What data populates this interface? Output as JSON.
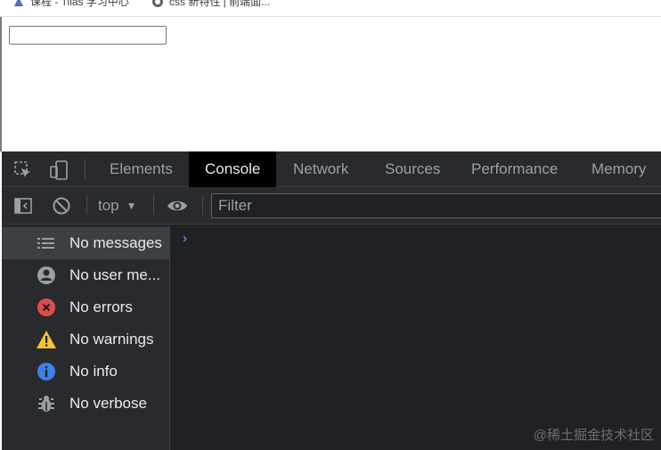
{
  "bookmarks": [
    {
      "label": "课程 - Tilas 学习中心",
      "icon": "bookmark-logo-icon"
    },
    {
      "label": "css 新特性 | 前端面...",
      "icon": "globe-icon"
    }
  ],
  "page": {
    "input_value": ""
  },
  "devtools": {
    "tabs": [
      {
        "label": "Elements",
        "active": false
      },
      {
        "label": "Console",
        "active": true
      },
      {
        "label": "Network",
        "active": false
      },
      {
        "label": "Sources",
        "active": false
      },
      {
        "label": "Performance",
        "active": false
      },
      {
        "label": "Memory",
        "active": false
      }
    ],
    "toolbar": {
      "context": "top",
      "filter_placeholder": "Filter"
    },
    "sidebar": [
      {
        "label": "No messages",
        "icon": "list-icon",
        "selected": true
      },
      {
        "label": "No user me...",
        "icon": "user-icon",
        "selected": false
      },
      {
        "label": "No errors",
        "icon": "error-icon",
        "selected": false
      },
      {
        "label": "No warnings",
        "icon": "warning-icon",
        "selected": false
      },
      {
        "label": "No info",
        "icon": "info-icon",
        "selected": false
      },
      {
        "label": "No verbose",
        "icon": "verbose-bug-icon",
        "selected": false
      }
    ],
    "prompt_symbol": "›"
  },
  "watermark": "@稀土掘金技术社区",
  "colors": {
    "devtools_bg": "#202124",
    "panel_bg": "#292a2d",
    "active_tab_bg": "#000000",
    "text": "#e8eaed",
    "muted_text": "#9aa0a6",
    "error": "#e04b4b",
    "warning": "#f9c12e",
    "info": "#3f7fe8",
    "accent": "#4c8df6"
  }
}
